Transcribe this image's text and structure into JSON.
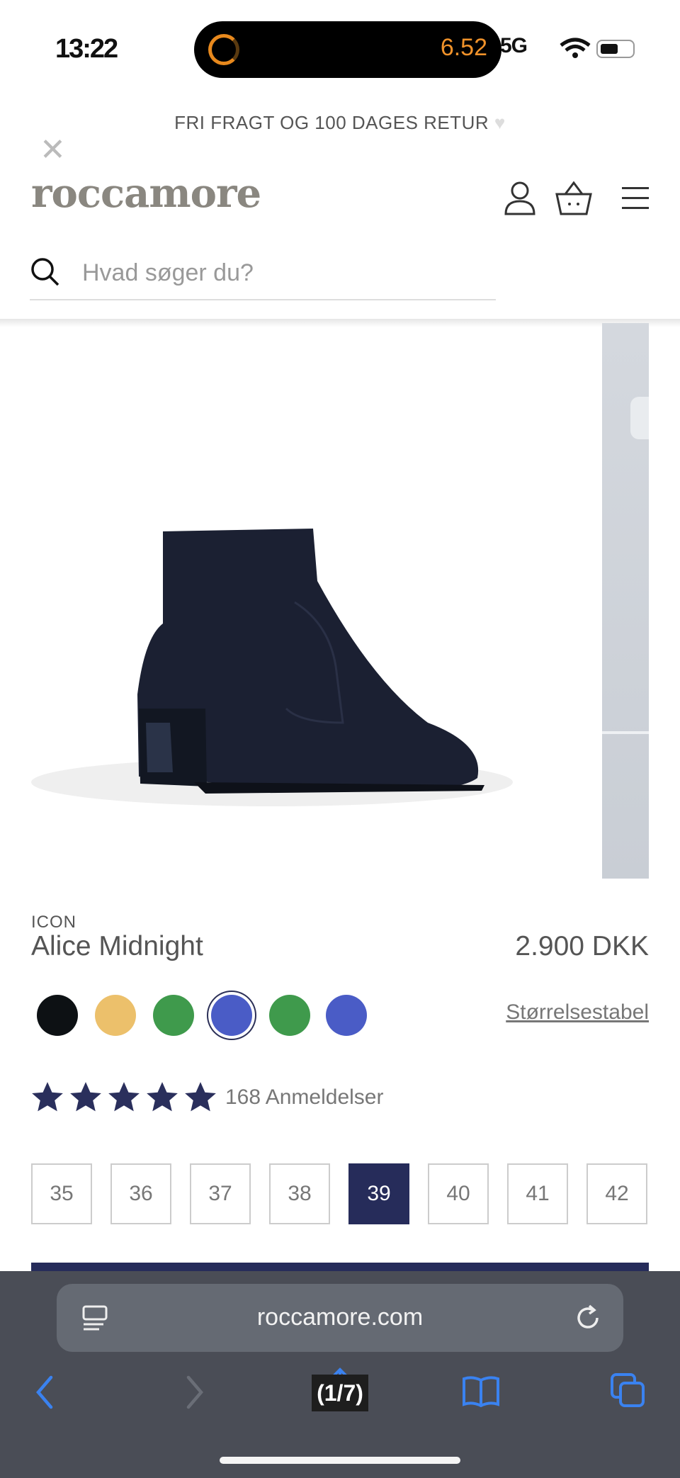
{
  "status_bar": {
    "time": "13:22",
    "timer": "6.52",
    "network": "5G"
  },
  "promo_banner": {
    "text": "FRI FRAGT OG 100 DAGES RETUR"
  },
  "header": {
    "logo": "roccamore",
    "search_placeholder": "Hvad søger du?"
  },
  "product": {
    "brand": "ICON",
    "name": "Alice Midnight",
    "price": "2.900 DKK",
    "size_guide_link": "Størrelsestabel",
    "rating": 5,
    "reviews_label": "168 Anmeldelser",
    "swatches": [
      {
        "color": "#0d1114"
      },
      {
        "color": "#ecc06b"
      },
      {
        "color": "#3f9a4c"
      },
      {
        "color": "#4a5cc6",
        "selected": true
      },
      {
        "color": "#3f9a4c"
      },
      {
        "color": "#4a5cc6"
      }
    ],
    "sizes": [
      "35",
      "36",
      "37",
      "38",
      "39",
      "40",
      "41",
      "42"
    ],
    "selected_size": "39"
  },
  "browser": {
    "url": "roccamore.com",
    "tab_counter": "(1/7)"
  },
  "colors": {
    "navy": "#262c5a",
    "star": "#2a2f5c"
  }
}
